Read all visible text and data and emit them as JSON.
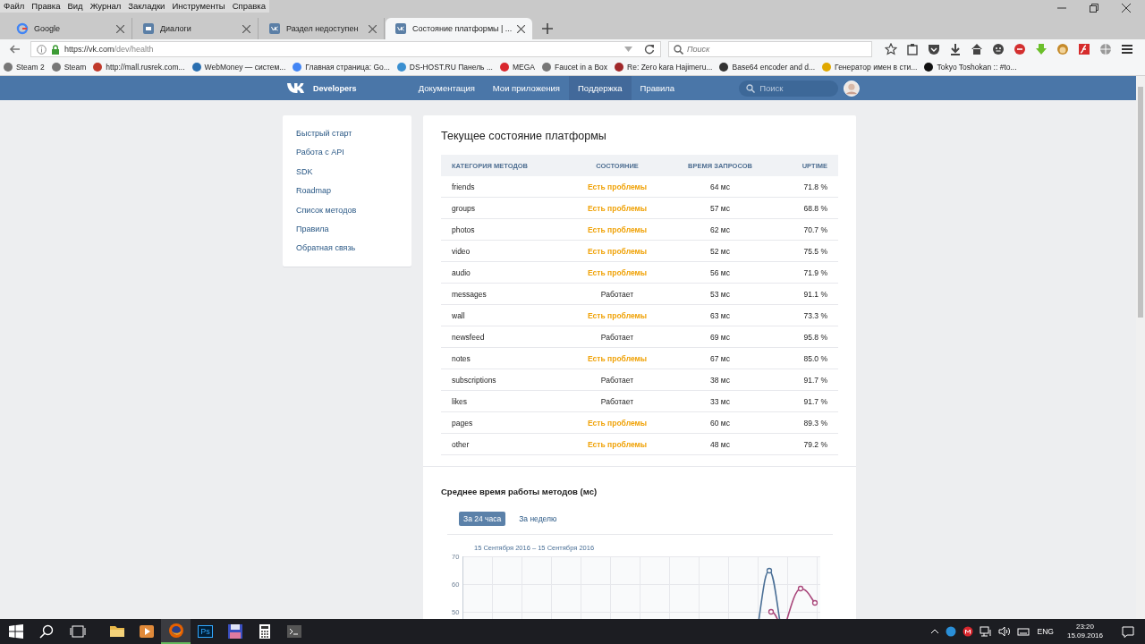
{
  "menu_bar": [
    "Файл",
    "Правка",
    "Вид",
    "Журнал",
    "Закладки",
    "Инструменты",
    "Справка"
  ],
  "tabs": [
    {
      "label": "Google",
      "selected": false
    },
    {
      "label": "Диалоги",
      "selected": false
    },
    {
      "label": "Раздел недоступен",
      "selected": false
    },
    {
      "label": "Состояние платформы | ...",
      "selected": true
    }
  ],
  "address_bar": {
    "url_host": "https://vk.com",
    "url_path": "/dev/health"
  },
  "search_bar": {
    "placeholder": "Поиск"
  },
  "bookmarks": [
    {
      "label": "Steam 2",
      "color": "#777777"
    },
    {
      "label": "Steam",
      "color": "#777777"
    },
    {
      "label": "http://mall.rusrek.com...",
      "color": "#c0392b"
    },
    {
      "label": "WebMoney — систем...",
      "color": "#2a6fb0"
    },
    {
      "label": "Главная страница: Go...",
      "color": "#4285f4"
    },
    {
      "label": "DS-HOST.RU Панель ...",
      "color": "#3a8fd0"
    },
    {
      "label": "MEGA",
      "color": "#d9272e"
    },
    {
      "label": "Faucet in a Box",
      "color": "#777777"
    },
    {
      "label": "Re: Zero kara Hajimeru...",
      "color": "#a0282a"
    },
    {
      "label": "Base64 encoder and d...",
      "color": "#333333"
    },
    {
      "label": "Генератор имен в сти...",
      "color": "#e0a800"
    },
    {
      "label": "Tokyo Toshokan :: #to...",
      "color": "#111111"
    }
  ],
  "site_header": {
    "logo_text": "Developers",
    "nav": [
      {
        "label": "Документация",
        "selected": false
      },
      {
        "label": "Мои приложения",
        "selected": false
      },
      {
        "label": "Поддержка",
        "selected": true
      },
      {
        "label": "Правила",
        "selected": false
      }
    ],
    "search_placeholder": "Поиск"
  },
  "sidebar": {
    "items": [
      {
        "label": "Быстрый старт",
        "selected": false
      },
      {
        "label": "Работа с API",
        "selected": false
      },
      {
        "label": "SDK",
        "selected": false
      },
      {
        "label": "Roadmap",
        "selected": false
      },
      {
        "label": "Список методов",
        "selected": false
      },
      {
        "label": "Правила",
        "selected": false
      },
      {
        "label": "Обратная связь",
        "selected": false
      }
    ]
  },
  "status_table": {
    "title": "Текущее состояние платформы",
    "columns": [
      "КАТЕГОРИЯ МЕТОДОВ",
      "СОСТОЯНИЕ",
      "ВРЕМЯ ЗАПРОСОВ",
      "UPTIME"
    ],
    "rows": [
      {
        "category": "friends",
        "status": "Есть проблемы",
        "problem": true,
        "time": "64 мс",
        "uptime": "71.8 %"
      },
      {
        "category": "groups",
        "status": "Есть проблемы",
        "problem": true,
        "time": "57 мс",
        "uptime": "68.8 %"
      },
      {
        "category": "photos",
        "status": "Есть проблемы",
        "problem": true,
        "time": "62 мс",
        "uptime": "70.7 %"
      },
      {
        "category": "video",
        "status": "Есть проблемы",
        "problem": true,
        "time": "52 мс",
        "uptime": "75.5 %"
      },
      {
        "category": "audio",
        "status": "Есть проблемы",
        "problem": true,
        "time": "56 мс",
        "uptime": "71.9 %"
      },
      {
        "category": "messages",
        "status": "Работает",
        "problem": false,
        "time": "53 мс",
        "uptime": "91.1 %"
      },
      {
        "category": "wall",
        "status": "Есть проблемы",
        "problem": true,
        "time": "63 мс",
        "uptime": "73.3 %"
      },
      {
        "category": "newsfeed",
        "status": "Работает",
        "problem": false,
        "time": "69 мс",
        "uptime": "95.8 %"
      },
      {
        "category": "notes",
        "status": "Есть проблемы",
        "problem": true,
        "time": "67 мс",
        "uptime": "85.0 %"
      },
      {
        "category": "subscriptions",
        "status": "Работает",
        "problem": false,
        "time": "38 мс",
        "uptime": "91.7 %"
      },
      {
        "category": "likes",
        "status": "Работает",
        "problem": false,
        "time": "33 мс",
        "uptime": "91.7 %"
      },
      {
        "category": "pages",
        "status": "Есть проблемы",
        "problem": true,
        "time": "60 мс",
        "uptime": "89.3 %"
      },
      {
        "category": "other",
        "status": "Есть проблемы",
        "problem": true,
        "time": "48 мс",
        "uptime": "79.2 %"
      }
    ]
  },
  "response_chart": {
    "title": "Среднее время работы методов (мс)",
    "periods": [
      {
        "label": "За 24 часа",
        "selected": true
      },
      {
        "label": "За неделю",
        "selected": false
      }
    ],
    "date_range": "15 Сентября 2016 – 15 Сентября 2016",
    "y_axis_labels": [
      "70",
      "60",
      "50"
    ]
  },
  "taskbar": {
    "apps": [
      {
        "kind": "folder",
        "selected": false
      },
      {
        "kind": "player",
        "selected": false
      },
      {
        "kind": "firefox",
        "selected": true
      },
      {
        "kind": "ps",
        "selected": false
      },
      {
        "kind": "save",
        "selected": false
      },
      {
        "kind": "calc",
        "selected": false
      },
      {
        "kind": "terminal",
        "selected": false
      }
    ],
    "ps_label": "Ps",
    "language": "ENG",
    "time": "23:20",
    "date": "15.09.2016"
  }
}
